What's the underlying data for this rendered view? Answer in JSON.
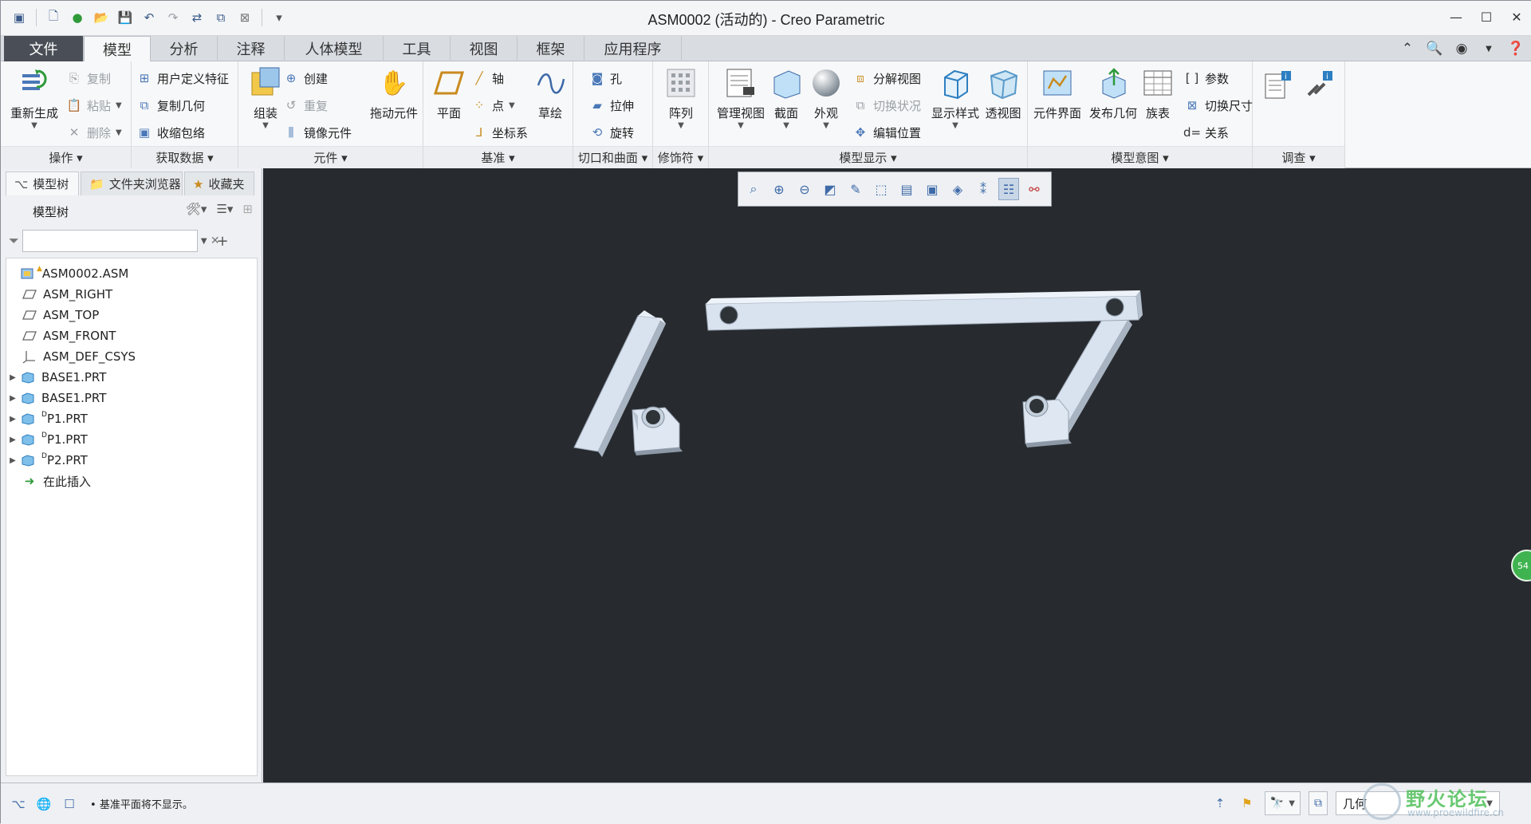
{
  "window": {
    "title": "ASM0002 (活动的) - Creo Parametric",
    "controls": [
      "minimize-icon",
      "maximize-icon",
      "close-icon"
    ]
  },
  "quick_access": [
    "new-icon",
    "open-icon",
    "folder-icon",
    "save-icon",
    "undo-icon",
    "redo-icon",
    "regenerate-icon",
    "windows-icon",
    "close-window-icon",
    "customize-icon"
  ],
  "tabs": [
    {
      "label": "文件"
    },
    {
      "label": "模型"
    },
    {
      "label": "分析"
    },
    {
      "label": "注释"
    },
    {
      "label": "人体模型"
    },
    {
      "label": "工具"
    },
    {
      "label": "视图"
    },
    {
      "label": "框架"
    },
    {
      "label": "应用程序"
    }
  ],
  "ribbon": {
    "operations": {
      "label": "操作",
      "regenerate": "重新生成",
      "copy": "复制",
      "paste": "粘贴",
      "delete": "删除"
    },
    "get_data": {
      "label": "获取数据",
      "udf": "用户定义特征",
      "copy_geom": "复制几何",
      "shrinkwrap": "收缩包络"
    },
    "component": {
      "label": "元件",
      "assemble": "组装",
      "create": "创建",
      "repeat": "重复",
      "mirror": "镜像元件",
      "drag": "拖动元件"
    },
    "datum": {
      "label": "基准",
      "plane": "平面",
      "axis": "轴",
      "point": "点",
      "csys": "坐标系",
      "sketch": "草绘"
    },
    "cut_surface": {
      "label": "切口和曲面",
      "hole": "孔",
      "extrude": "拉伸",
      "revolve": "旋转"
    },
    "modifiers": {
      "label": "修饰符",
      "pattern": "阵列"
    },
    "model_display": {
      "label": "模型显示",
      "manage_views": "管理视图",
      "section": "截面",
      "appearance": "外观",
      "explode": "分解视图",
      "toggle_status": "切换状况",
      "edit_position": "编辑位置",
      "display_style": "显示样式",
      "perspective": "透视图"
    },
    "model_intent": {
      "label": "模型意图",
      "comp_interface": "元件界面",
      "publish_geom": "发布几何",
      "family_table": "族表",
      "params": "参数",
      "switch_dims": "切换尺寸",
      "relations": "关系"
    },
    "investigate": {
      "label": "调查"
    }
  },
  "nav_tabs": [
    {
      "label": "模型树"
    },
    {
      "label": "文件夹浏览器"
    },
    {
      "label": "收藏夹"
    }
  ],
  "tree": {
    "title": "模型树",
    "filter_placeholder": "",
    "nodes": [
      {
        "label": "ASM0002.ASM",
        "icon": "assembly-icon",
        "expand": false
      },
      {
        "label": "ASM_RIGHT",
        "icon": "datum-plane-icon",
        "expand": false
      },
      {
        "label": "ASM_TOP",
        "icon": "datum-plane-icon",
        "expand": false
      },
      {
        "label": "ASM_FRONT",
        "icon": "datum-plane-icon",
        "expand": false
      },
      {
        "label": "ASM_DEF_CSYS",
        "icon": "csys-icon",
        "expand": false
      },
      {
        "label": "BASE1.PRT",
        "icon": "part-icon",
        "expand": true
      },
      {
        "label": "BASE1.PRT",
        "icon": "part-icon",
        "expand": true
      },
      {
        "label": "P1.PRT",
        "icon": "part-icon",
        "expand": true,
        "badge": "D"
      },
      {
        "label": "P1.PRT",
        "icon": "part-icon",
        "expand": true,
        "badge": "D"
      },
      {
        "label": "P2.PRT",
        "icon": "part-icon",
        "expand": true,
        "badge": "D"
      },
      {
        "label": "在此插入",
        "icon": "insert-arrow-icon",
        "expand": false
      }
    ]
  },
  "graphics_toolbar": [
    "refit-icon",
    "zoom-in-icon",
    "zoom-out-icon",
    "repaint-icon",
    "spin-center-icon",
    "shading-icon",
    "saved-views-icon",
    "view-manager-icon",
    "section-icon",
    "datum-display-icon",
    "annotation-display-icon",
    "mechanism-icon"
  ],
  "status": {
    "message": "基准平面将不显示。",
    "selection_filter": "几何"
  },
  "badge_bubble": "54",
  "watermark": {
    "line1": "野火论坛",
    "line2": "www.proewildfire.cn"
  },
  "colors": {
    "viewport": "#272b2f",
    "model": "#d9e2ef",
    "file_tab": "#4a4f57"
  }
}
